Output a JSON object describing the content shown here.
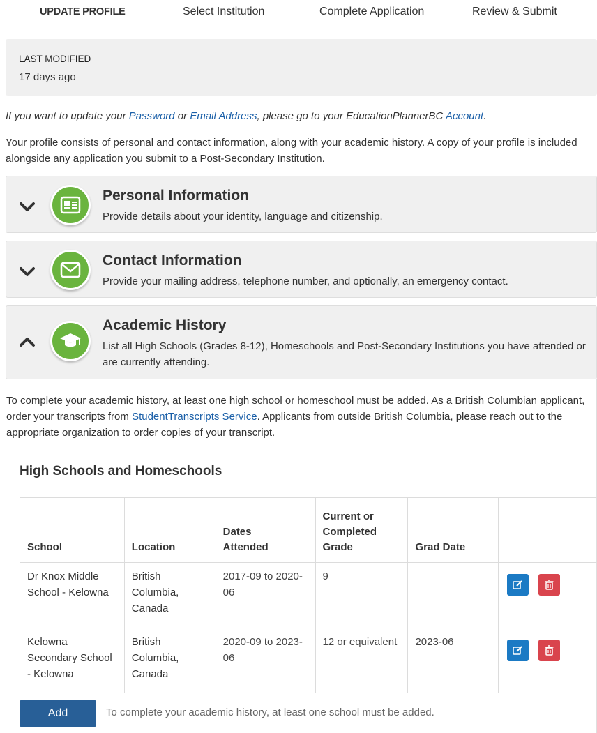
{
  "steps": [
    {
      "label": "UPDATE PROFILE",
      "active": true
    },
    {
      "label": "Select Institution",
      "active": false
    },
    {
      "label": "Complete Application",
      "active": false
    },
    {
      "label": "Review & Submit",
      "active": false
    }
  ],
  "last_modified": {
    "label": "LAST MODIFIED",
    "value": "17 days ago"
  },
  "note": {
    "prefix": "If you want to update your ",
    "password_link": "Password",
    "or": " or ",
    "email_link": "Email Address",
    "middle": ", please go to your EducationPlannerBC ",
    "account_link": "Account",
    "suffix": "."
  },
  "intro": "Your profile consists of personal and contact information, along with your academic history. A copy of your profile is included alongside any application you submit to a Post-Secondary Institution.",
  "sections": {
    "personal": {
      "title": "Personal Information",
      "desc": "Provide details about your identity, language and citizenship."
    },
    "contact": {
      "title": "Contact Information",
      "desc": "Provide your mailing address, telephone number, and optionally, an emergency contact."
    },
    "academic": {
      "title": "Academic History",
      "desc": "List all High Schools (Grades 8-12), Homeschools and Post-Secondary Institutions you have attended or are currently attending."
    }
  },
  "academic_body": {
    "para_prefix": "To complete your academic history, at least one high school or homeschool must be added. As a British Columbian applicant, order your transcripts from ",
    "para_link": "StudentTranscripts Service",
    "para_suffix": ". Applicants from outside British Columbia, please reach out to the appropriate organization to order copies of your transcript.",
    "section_title": "High Schools and Homeschools",
    "columns": [
      "School",
      "Location",
      "Dates Attended",
      "Current or Completed Grade",
      "Grad Date",
      ""
    ],
    "rows": [
      {
        "school": "Dr Knox Middle School - Kelowna",
        "location": "British Columbia, Canada",
        "dates": "2017-09 to 2020-06",
        "grade": "9",
        "grad": ""
      },
      {
        "school": "Kelowna Secondary School - Kelowna",
        "location": "British Columbia, Canada",
        "dates": "2020-09 to 2023-06",
        "grade": "12 or equivalent",
        "grad": "2023-06"
      }
    ],
    "add_label": "Add",
    "add_note": "To complete your academic history, at least one school must be added."
  },
  "colors": {
    "accent_green": "#6ab43e",
    "link_blue": "#1a5fa8",
    "edit_blue": "#1b7ac4",
    "delete_red": "#d9444d",
    "add_navy": "#285f97"
  },
  "icons": [
    "chevron-down-icon",
    "id-card-icon",
    "envelope-icon",
    "chevron-up-icon",
    "graduation-cap-icon",
    "edit-icon",
    "trash-icon"
  ]
}
